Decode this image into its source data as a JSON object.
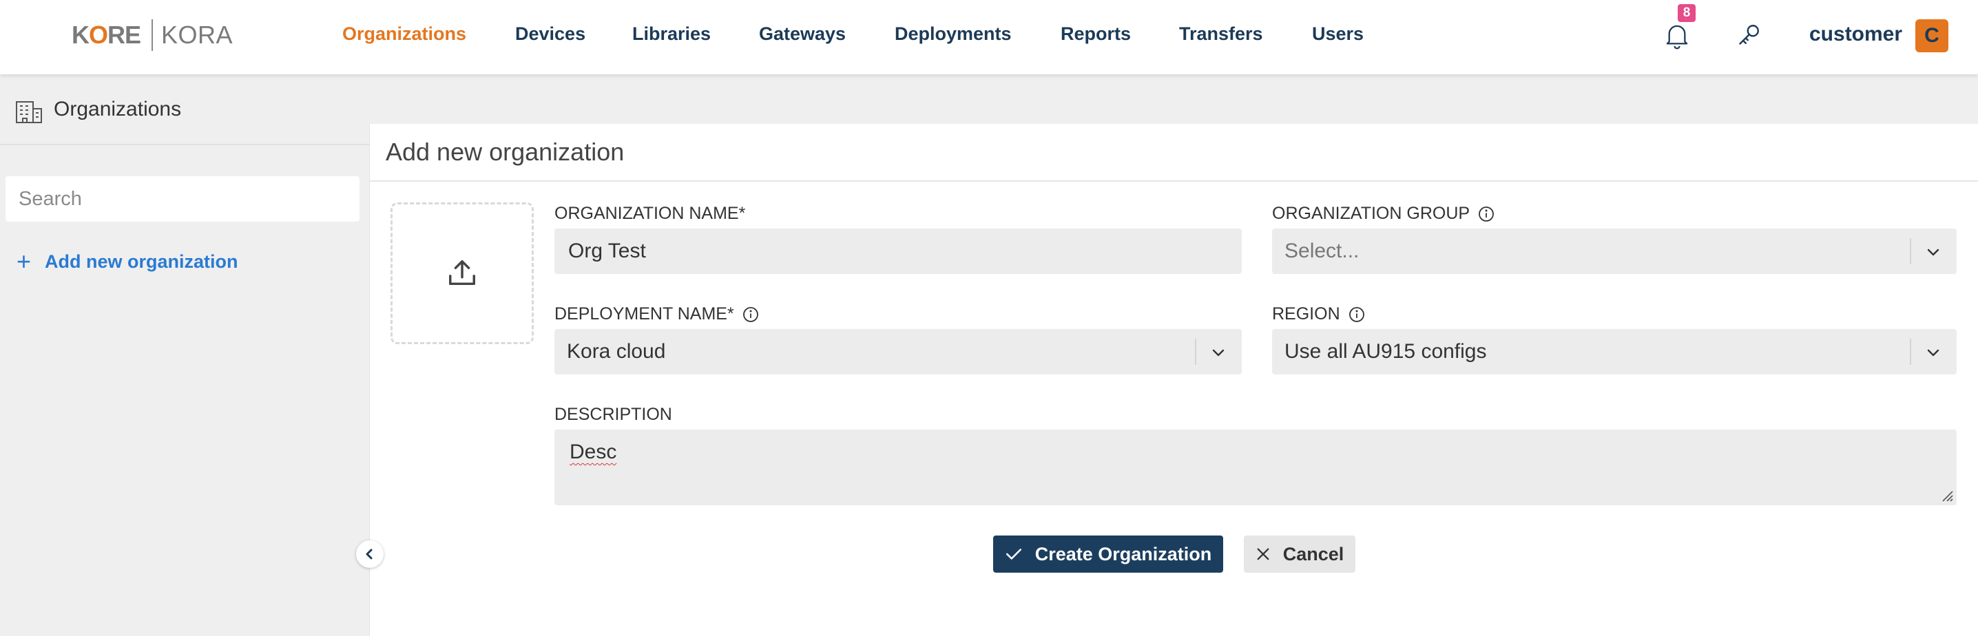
{
  "brand": {
    "logo_left": "KORE",
    "logo_right": "KORA"
  },
  "nav": {
    "items": [
      {
        "label": "Organizations",
        "active": true
      },
      {
        "label": "Devices",
        "active": false
      },
      {
        "label": "Libraries",
        "active": false
      },
      {
        "label": "Gateways",
        "active": false
      },
      {
        "label": "Deployments",
        "active": false
      },
      {
        "label": "Reports",
        "active": false
      },
      {
        "label": "Transfers",
        "active": false
      },
      {
        "label": "Users",
        "active": false
      }
    ]
  },
  "header": {
    "notification_count": "8",
    "username": "customer",
    "avatar_letter": "C",
    "icons": [
      "bell-icon",
      "key-icon"
    ]
  },
  "sidebar": {
    "title": "Organizations",
    "search_placeholder": "Search",
    "add_label": "Add new organization"
  },
  "form": {
    "title": "Add new organization",
    "org_name": {
      "label": "ORGANIZATION NAME*",
      "value": "Org Test"
    },
    "org_group": {
      "label": "ORGANIZATION GROUP",
      "placeholder": "Select..."
    },
    "deployment": {
      "label": "DEPLOYMENT NAME*",
      "value": "Kora cloud"
    },
    "region": {
      "label": "REGION",
      "value": "Use all AU915 configs"
    },
    "description": {
      "label": "DESCRIPTION",
      "value": "Desc"
    },
    "create_label": "Create Organization",
    "cancel_label": "Cancel"
  },
  "colors": {
    "accent_orange": "#e4761f",
    "nav_navy": "#1c3a57",
    "link_blue": "#2a7ad2",
    "badge_pink": "#e64b8a",
    "primary_button": "#1c3e5e"
  }
}
